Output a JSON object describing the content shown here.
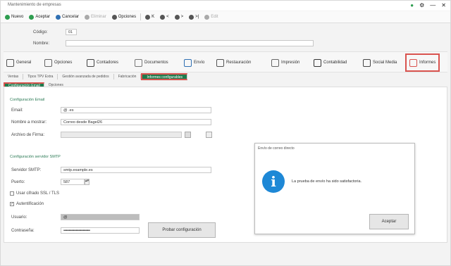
{
  "window": {
    "title": "Mantenimiento de empresas",
    "controls": [
      "●",
      "⚙",
      "—",
      "✕"
    ]
  },
  "toolbar": {
    "items": [
      {
        "icon": "new-icon",
        "label": "Nuevo",
        "color": "#2e9d4f",
        "enabled": true
      },
      {
        "icon": "check-icon",
        "label": "Aceptar",
        "color": "#2e9d4f",
        "enabled": true
      },
      {
        "icon": "cancel-icon",
        "label": "Cancelar",
        "color": "#2f6fb2",
        "enabled": true
      },
      {
        "icon": "delete-icon",
        "label": "Eliminar",
        "color": "#aaaaaa",
        "enabled": false
      },
      {
        "icon": "options-icon",
        "label": "Opciones",
        "color": "#555555",
        "enabled": true
      },
      {
        "icon": "first-icon",
        "label": "K",
        "color": "#555555",
        "enabled": true
      },
      {
        "icon": "prev-icon",
        "label": "<",
        "color": "#555555",
        "enabled": true
      },
      {
        "icon": "next-icon",
        "label": ">",
        "color": "#555555",
        "enabled": true
      },
      {
        "icon": "last-icon",
        "label": ">|",
        "color": "#555555",
        "enabled": true
      },
      {
        "icon": "edit-icon",
        "label": "Edit",
        "color": "#aaaaaa",
        "enabled": false
      }
    ]
  },
  "form": {
    "code_label": "Código:",
    "code_value": "01",
    "name_label": "Nombre:",
    "name_value": ""
  },
  "categories": [
    {
      "label": "General",
      "icon": "general-icon"
    },
    {
      "label": "Opciones",
      "icon": "options-icon"
    },
    {
      "label": "Contadores",
      "icon": "counters-icon"
    },
    {
      "label": "Documentos",
      "icon": "documents-icon"
    },
    {
      "label": "Envío",
      "icon": "shipping-icon"
    },
    {
      "label": "Restauración",
      "icon": "restaurant-icon"
    },
    {
      "label": "Impresión",
      "icon": "print-icon"
    },
    {
      "label": "Contabilidad",
      "icon": "accounting-icon"
    },
    {
      "label": "Social Media",
      "icon": "social-icon"
    },
    {
      "label": "Informes",
      "icon": "reports-icon"
    }
  ],
  "subtabs": [
    "Ventas",
    "Tipos TPV Extra",
    "Gestión avanzada de pedidos",
    "Fabricación",
    "Informes configurables"
  ],
  "subtabs_active": "Informes configurables",
  "tabs2": [
    "Configuración Email",
    "Opciones"
  ],
  "email": {
    "section": "Configuración Email",
    "email_label": "Email:",
    "email_value": "@      .es",
    "sender_label": "Nombre a mostrar:",
    "sender_value": "Correo desde Bagel26",
    "signature_label": "Archivo de Firma:",
    "signature_value": ""
  },
  "smtp": {
    "section": "Configuración servidor SMTP",
    "server_label": "Servidor SMTP:",
    "server_value": "smtp.example.es",
    "port_label": "Puerto:",
    "port_value": "587",
    "ssl_label": "Usar cifrado SSL / TLS",
    "auth_label": "Autentificación",
    "user_label": "Usuario:",
    "user_value": "@",
    "password_label": "Contraseña:",
    "password_value": "••••••••••••••••••••••••••••••",
    "test_button": "Probar configuración"
  },
  "dialog": {
    "title": "Envío de correo directo",
    "message": "La prueba de envío ha sido satisfactoria.",
    "ok_button": "Aceptar",
    "icon_color": "#1e88d6"
  },
  "colors": {
    "accent_green": "#1f7a4c",
    "highlight_red": "#d9534f"
  }
}
